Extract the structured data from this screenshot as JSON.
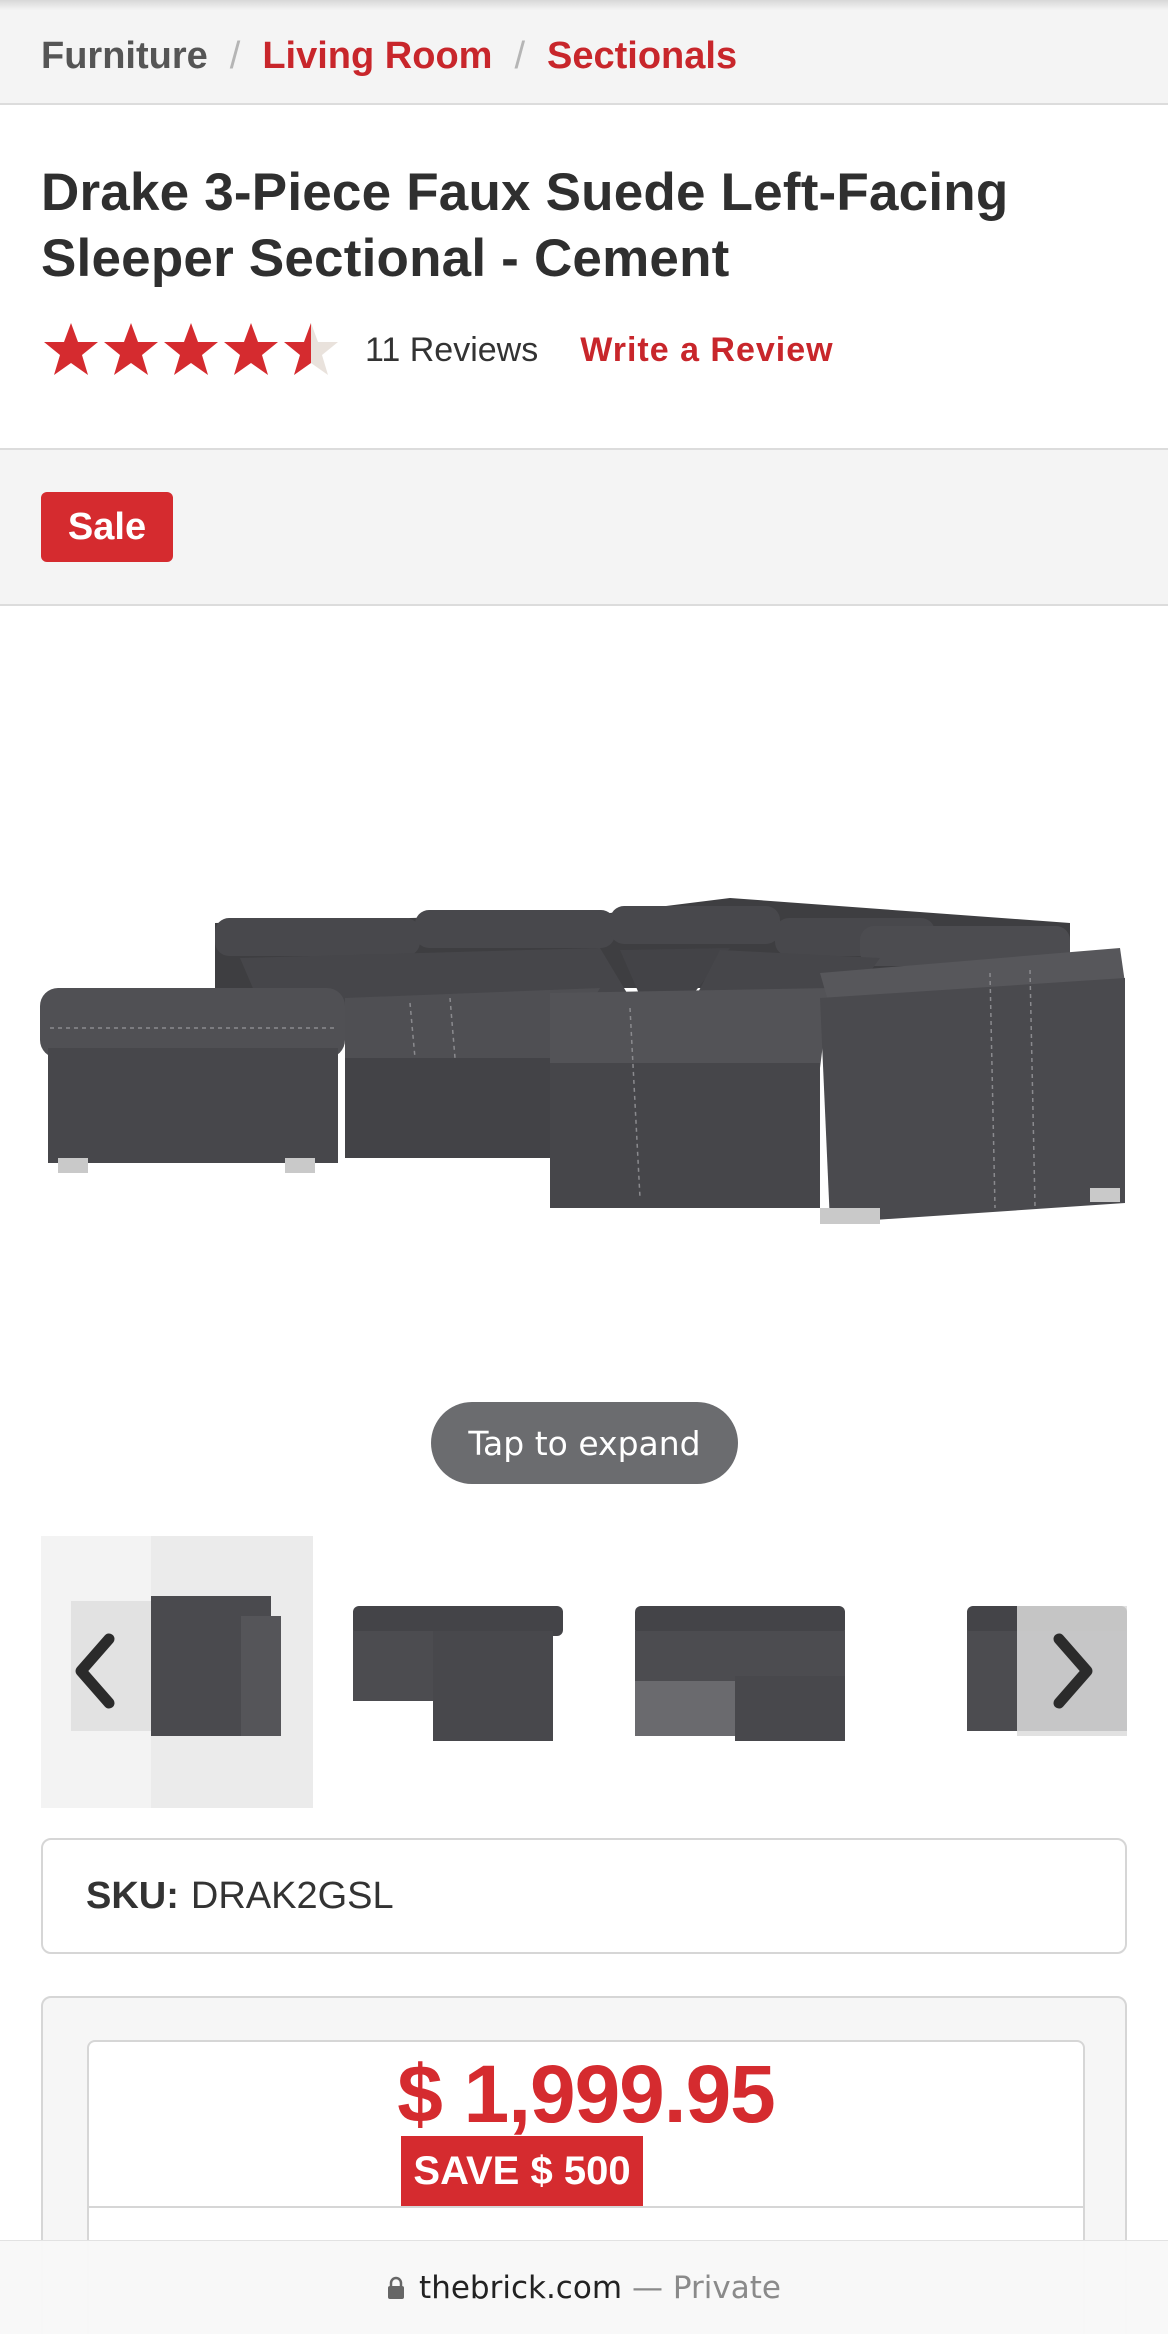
{
  "breadcrumb": {
    "items": [
      {
        "label": "Furniture",
        "style": "plain"
      },
      {
        "label": "Living Room",
        "style": "link"
      },
      {
        "label": "Sectionals",
        "style": "link"
      }
    ],
    "separator": "/"
  },
  "product": {
    "title": "Drake 3-Piece Faux Suede Left-Facing Sleeper Sectional - Cement",
    "rating": 4.5,
    "rating_max": 5,
    "reviews_label": "11 Reviews",
    "write_review_label": "Write a Review",
    "sale_badge": "Sale",
    "expand_label": "Tap to expand",
    "sku_label": "SKU:",
    "sku_value": "DRAK2GSL",
    "price": "$ 1,999.95",
    "save_label": "SAVE $ 500"
  },
  "gallery": {
    "thumbnail_count": 4,
    "active_index": 0,
    "prev_icon": "chevron-left-icon",
    "next_icon": "chevron-right-icon"
  },
  "browser": {
    "domain": "thebrick.com",
    "privacy": "— Private",
    "lock_icon": "lock-icon"
  },
  "colors": {
    "brand_red": "#d52b2f",
    "link_red": "#c8262b",
    "star_empty": "#e9e2dc",
    "sofa": "#4a4a4d"
  }
}
